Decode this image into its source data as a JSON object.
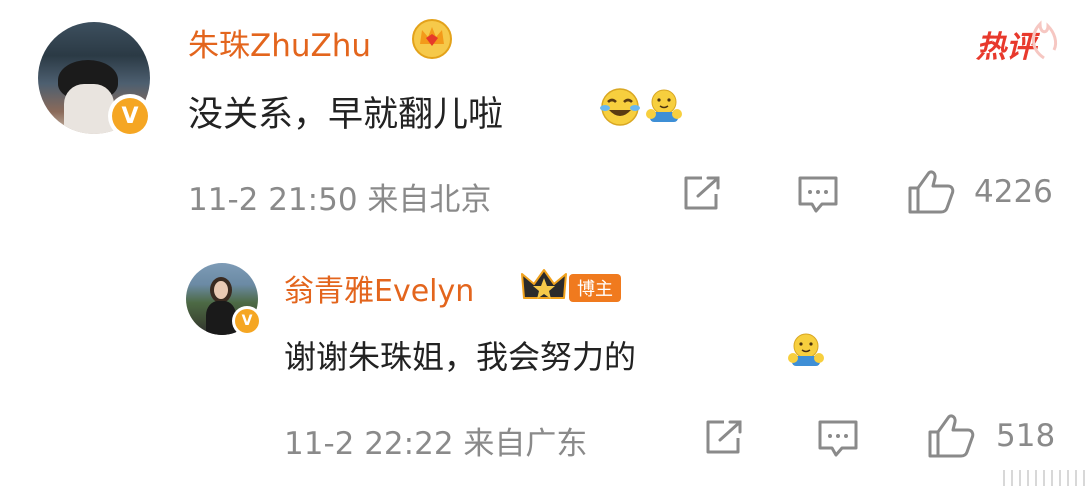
{
  "hot_label": "热评",
  "comments": [
    {
      "author": "朱珠ZhuZhu",
      "text": "没关系，早就翻儿啦",
      "meta": "11-2 21:50 来自北京",
      "likes": "4226"
    },
    {
      "author": "翁青雅Evelyn",
      "tag": "博主",
      "text": "谢谢朱珠姐，我会努力的",
      "meta": "11-2 22:22 来自广东",
      "likes": "518"
    }
  ],
  "icons": {
    "share": "share-icon",
    "comment": "comment-icon",
    "like": "like-icon",
    "verified": "verified-badge-icon",
    "crown": "crown-icon"
  },
  "colors": {
    "name": "#e3651d",
    "meta": "#8a8a8a",
    "hot": "#e8392c",
    "badge": "#f5a623"
  }
}
